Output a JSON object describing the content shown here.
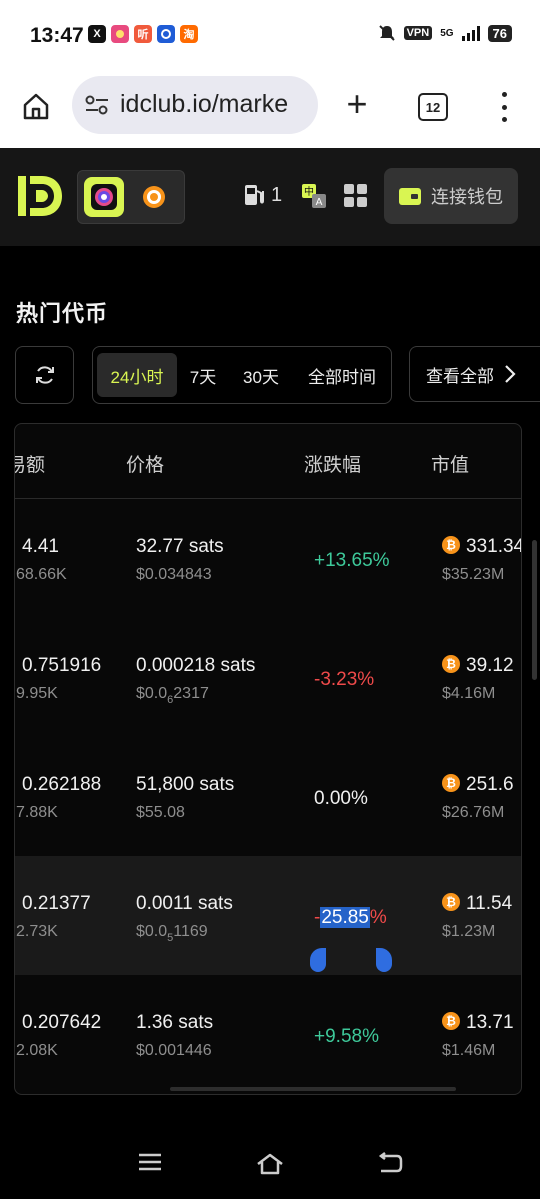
{
  "status_bar": {
    "time": "13:47",
    "apps": [
      {
        "icon": "x-app-icon",
        "label": "X",
        "color": "#111111"
      },
      {
        "icon": "game-app-icon",
        "label": "",
        "color": "#e84a7f"
      },
      {
        "icon": "music-app-icon",
        "label": "听",
        "color": "#f05a3c"
      },
      {
        "icon": "browser-app-icon",
        "label": "",
        "color": "#1f5cd6"
      },
      {
        "icon": "taobao-app-icon",
        "label": "淘",
        "color": "#ff6a00"
      }
    ],
    "vpn": "VPN",
    "network": "5G",
    "battery": "76"
  },
  "browser": {
    "url": "idclub.io/marke",
    "tab_count": "12"
  },
  "header": {
    "gas_count": "1",
    "wallet_label": "连接钱包",
    "colors": {
      "accent": "#d9f552"
    }
  },
  "section": {
    "title": "热门代币",
    "timeframes": [
      "24小时",
      "7天",
      "30天",
      "全部时间"
    ],
    "active_timeframe": "24小时",
    "view_all": "查看全部"
  },
  "table": {
    "columns": [
      "易额",
      "价格",
      "涨跌幅",
      "市值"
    ],
    "rows": [
      {
        "volume": "4.41",
        "volume_usd": "68.66K",
        "price": "32.77 sats",
        "price_usd": "$0.034843",
        "price_usd_parts": null,
        "change": "+13.65%",
        "change_type": "pos",
        "mcap": "331.34",
        "mcap_usd": "$35.23M"
      },
      {
        "volume": "0.751916",
        "volume_usd": "9.95K",
        "price": "0.000218 sats",
        "price_usd": "",
        "price_usd_parts": {
          "pre": "$0.0",
          "sub": "6",
          "post": "2317"
        },
        "change": "-3.23%",
        "change_type": "neg",
        "mcap": "39.12",
        "mcap_usd": "$4.16M"
      },
      {
        "volume": "0.262188",
        "volume_usd": "7.88K",
        "price": "51,800 sats",
        "price_usd": "$55.08",
        "price_usd_parts": null,
        "change": "0.00%",
        "change_type": "neu",
        "mcap": "251.6",
        "mcap_usd": "$26.76M"
      },
      {
        "volume": "0.21377",
        "volume_usd": "2.73K",
        "price": "0.0011 sats",
        "price_usd": "",
        "price_usd_parts": {
          "pre": "$0.0",
          "sub": "5",
          "post": "1169"
        },
        "change": "-25.85%",
        "change_type": "neg",
        "mcap": "11.54",
        "mcap_usd": "$1.23M"
      },
      {
        "volume": "0.207642",
        "volume_usd": "2.08K",
        "price": "1.36 sats",
        "price_usd": "$0.001446",
        "price_usd_parts": null,
        "change": "+9.58%",
        "change_type": "pos",
        "mcap": "13.71",
        "mcap_usd": "$1.46M"
      }
    ],
    "selected_row_index": 3,
    "selected_text": {
      "leading": "-",
      "selected": "25.85",
      "trailing": "%"
    }
  },
  "colors": {
    "positive": "#3ec99a",
    "negative": "#ef4a4a",
    "bitcoin": "#f7931a",
    "selection": "#2563c9"
  }
}
